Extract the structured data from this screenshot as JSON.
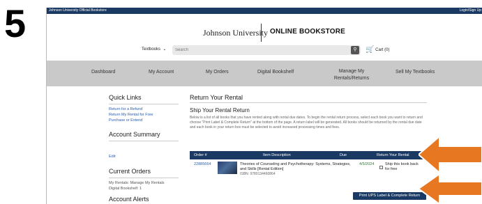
{
  "step_number": "5",
  "topbar": {
    "left_text": "Johnson University Official Bookstore",
    "right_text": "Login/Sign Up"
  },
  "brand": {
    "university": "Johnson University",
    "store": "ONLINE BOOKSTORE"
  },
  "search": {
    "category": "Textbooks",
    "placeholder": "Search",
    "cart_label": "Cart (0)"
  },
  "nav": {
    "items": [
      "Dashboard",
      "My Account",
      "My Orders",
      "Digital Bookshelf",
      "Manage My Rentals/Returns",
      "Sell My Textbooks"
    ]
  },
  "sidebar": {
    "quick_links_heading": "Quick Links",
    "quick_links": [
      "Return for a Refund",
      "Return My Rental for Free",
      "Purchase or Extend"
    ],
    "account_summary_heading": "Account Summary",
    "edit_link": "Edit",
    "current_orders_heading": "Current Orders",
    "current_orders_lines": [
      "My Rentals: Manage My Rentals",
      "Digital Bookshelf: 1"
    ],
    "account_alerts_heading": "Account Alerts"
  },
  "main": {
    "title": "Return Your Rental",
    "section_title": "Ship Your Rental Return",
    "description": "Below is a list of all books that you have rented along with rental due dates. To begin the rental return process, select each book you want to return and choose \"Print Label & Complete Return\" at the bottom of the page. A return label will be generated. All books should be returned by the rental due date and each book in your return box must be selected to avoid increased processing times and fees.",
    "table": {
      "headers": [
        "Order #",
        "Item Description",
        "Due",
        "Return Your Rental"
      ],
      "rows": [
        {
          "order": "22885664",
          "title": "Theories of Counseling and Psychotherapy: Systems, Strategies, and Skills [Rental Edition]",
          "isbn": "ISBN: 9780134460864",
          "due": "4/5/2024",
          "ship_label": "Ship this book back for free"
        }
      ]
    },
    "print_button": "Print UPS Label & Complete Return"
  },
  "colors": {
    "navy": "#1b3a63",
    "arrow_orange": "#e87722",
    "nav_gray": "#c9c9c9",
    "link_blue": "#2a5db0"
  }
}
